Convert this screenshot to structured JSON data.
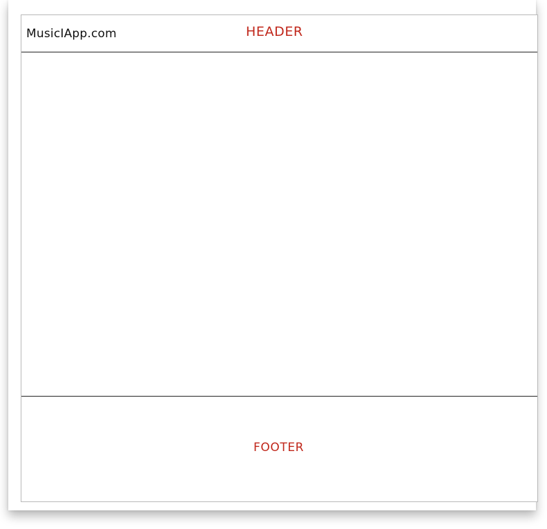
{
  "header": {
    "site_name": "MusicIApp.com",
    "label": "HEADER"
  },
  "footer": {
    "label": "FOOTER"
  },
  "colors": {
    "label_red": "#c0271b",
    "line": "#222222",
    "text": "#111111"
  }
}
